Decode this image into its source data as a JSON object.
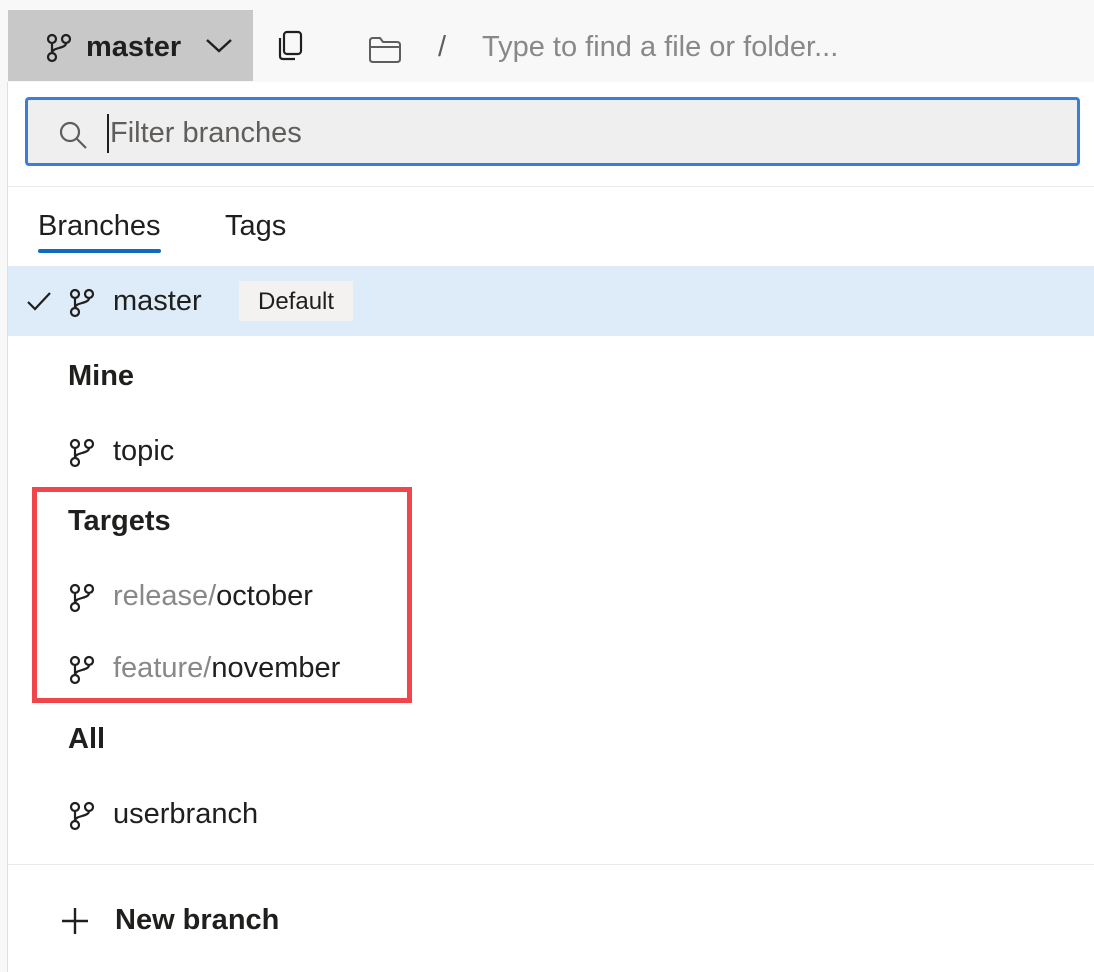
{
  "toolbar": {
    "branch_selector_label": "master",
    "path_separator": "/",
    "path_placeholder": "Type to find a file or folder..."
  },
  "dropdown": {
    "filter_placeholder": "Filter branches",
    "tabs": [
      {
        "label": "Branches",
        "active": true
      },
      {
        "label": "Tags",
        "active": false
      }
    ],
    "selected_branch": {
      "name": "master",
      "badge": "Default"
    },
    "groups": {
      "mine": {
        "heading": "Mine",
        "items": [
          {
            "name": "topic"
          }
        ]
      },
      "targets": {
        "heading": "Targets",
        "items": [
          {
            "prefix": "release/",
            "name": "october"
          },
          {
            "prefix": "feature/",
            "name": "november"
          }
        ]
      },
      "all": {
        "heading": "All",
        "items": [
          {
            "name": "userbranch"
          }
        ]
      }
    },
    "new_branch_label": "New branch"
  },
  "icons": {
    "branch": "git-branch-icon",
    "copy": "copy-icon",
    "folder": "folder-icon",
    "search": "search-icon",
    "check": "checkmark-icon",
    "chevron": "chevron-down-icon",
    "plus": "plus-icon"
  },
  "colors": {
    "accent": "#0f6cbd",
    "focus_border": "#3a7fd5",
    "selected_row": "#deecf9",
    "highlight_box": "#f0464b",
    "selector_bg": "#c8c8c8"
  }
}
